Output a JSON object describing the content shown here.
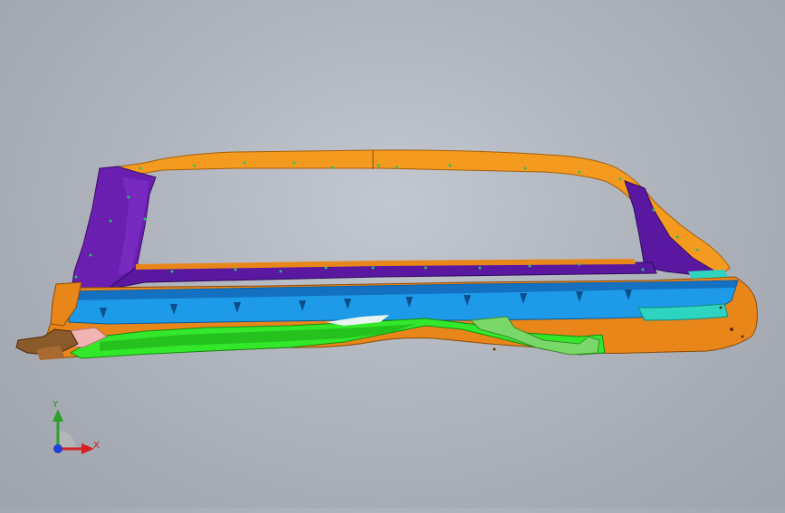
{
  "viewport": {
    "background_colors": [
      "#c3c7cf",
      "#9ea3ac"
    ],
    "model": {
      "part_colors": {
        "roof_rail": "#f39a1f",
        "a_pillar_inner": "#6a1fb0",
        "upper_rail_purple": "#5a18a0",
        "sill_blue": "#1e9be8",
        "lower_green": "#33e82b",
        "rocker_orange": "#e8861a",
        "teal_insert": "#2ed4c0",
        "pink_insert": "#f2b3b3",
        "bracket_brown": "#8a5a2a"
      }
    },
    "triad": {
      "x_label": "X",
      "y_label": "Y",
      "x_color": "#d42020",
      "y_color": "#2aa02a",
      "z_color": "#2040d8"
    }
  }
}
